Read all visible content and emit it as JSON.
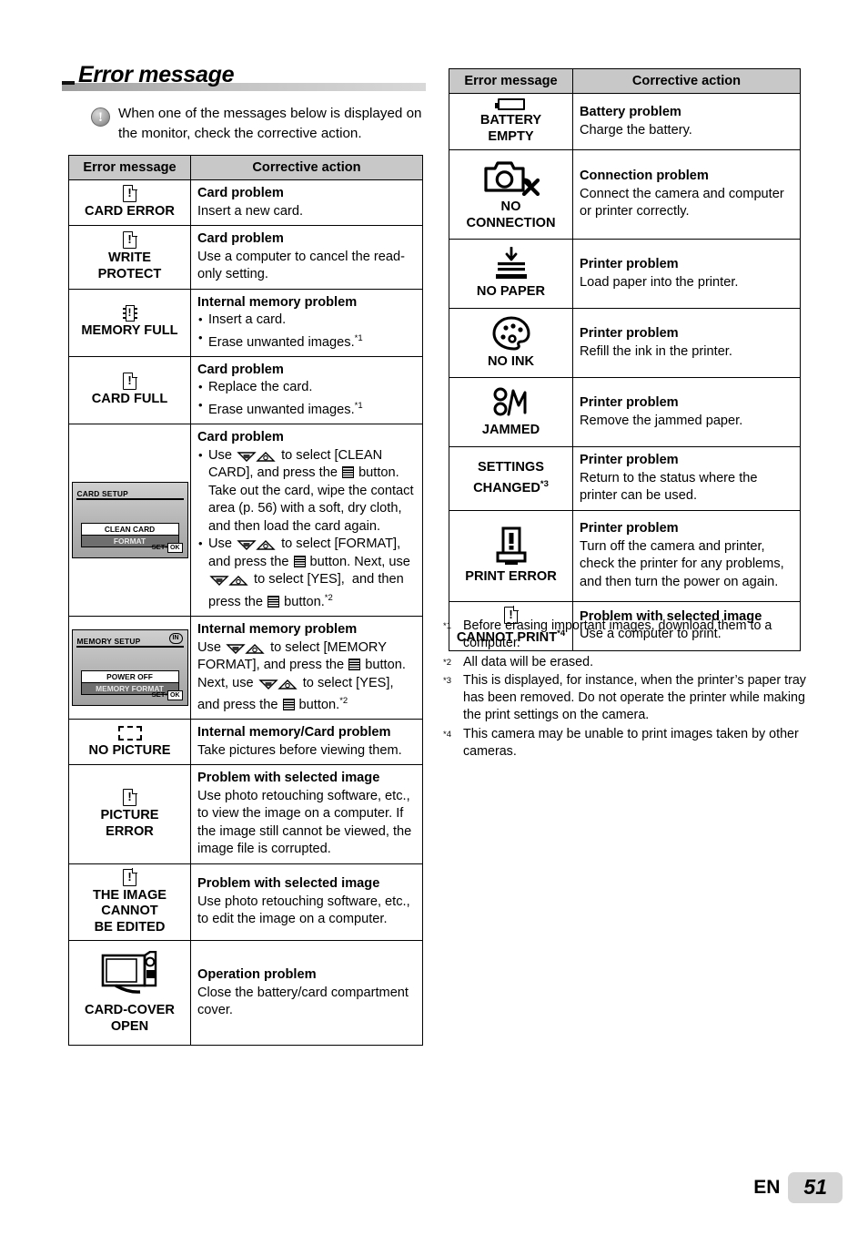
{
  "page": {
    "title": "Error message",
    "intro": "When one of the messages below is displayed on the monitor, check the corrective action.",
    "footer_lang": "EN",
    "footer_number": "51"
  },
  "table_headers": {
    "col_message": "Error message",
    "col_action": "Corrective action"
  },
  "left_table": [
    {
      "icon": "card-exclamation-icon",
      "label": "CARD ERROR",
      "action_heading": "Card problem",
      "action_lines": [
        "Insert a new card."
      ],
      "bullets": []
    },
    {
      "icon": "card-exclamation-icon",
      "label": "WRITE\nPROTECT",
      "action_heading": "Card problem",
      "action_lines": [
        "Use a computer to cancel the read-only setting."
      ],
      "bullets": []
    },
    {
      "icon": "memory-chip-exclamation-icon",
      "label": "MEMORY FULL",
      "action_heading": "Internal memory problem",
      "action_lines": [],
      "bullets": [
        "Insert a card.",
        "Erase unwanted images."
      ],
      "bullet_footnotes": [
        "",
        "*1"
      ]
    },
    {
      "icon": "card-exclamation-icon",
      "label": "CARD FULL",
      "action_heading": "Card problem",
      "action_lines": [],
      "bullets": [
        "Replace the card.",
        "Erase unwanted images."
      ],
      "bullet_footnotes": [
        "",
        "*1"
      ]
    },
    {
      "icon": "lcd-card-setup-screen",
      "label": "",
      "action_heading": "Card problem",
      "action_lines": [],
      "bullets": [
        "Use ▽/△ to select [CLEAN CARD], and press the ⊞ button. Take out the card, wipe the contact area (p. 56) with a soft, dry cloth, and then load the card again.",
        "Use ▽/△ to select [FORMAT], and press the ⊞ button. Next, use ▽/△ to select [YES],  and then press the ⊞ button."
      ],
      "bullet_footnotes": [
        "",
        "*2"
      ],
      "lcd": {
        "title": "CARD SETUP",
        "badge": "",
        "options": [
          "CLEAN CARD",
          "FORMAT"
        ],
        "footer": "SET•OK"
      }
    },
    {
      "icon": "lcd-memory-setup-screen",
      "label": "",
      "action_heading": "Internal memory problem",
      "action_lines": [
        "Use ▽/△ to select [MEMORY FORMAT], and press the ⊞ button. Next, use ▽/△ to select [YES], and press the ⊞ button."
      ],
      "bullets": [],
      "trailing_footnote": "*2",
      "lcd": {
        "title": "MEMORY SETUP",
        "badge": "IN",
        "options": [
          "POWER OFF",
          "MEMORY FORMAT"
        ],
        "footer": "SET•OK"
      }
    },
    {
      "icon": "dashed-frame-icon",
      "label": "NO PICTURE",
      "action_heading": "Internal memory/Card problem",
      "action_lines": [
        "Take pictures before viewing them."
      ],
      "bullets": []
    },
    {
      "icon": "card-exclamation-icon",
      "label": "PICTURE\nERROR",
      "action_heading": "Problem with selected image",
      "action_lines": [
        "Use photo retouching software, etc., to view the image on a computer. If the image still cannot be viewed, the image file is corrupted."
      ],
      "bullets": []
    },
    {
      "icon": "card-exclamation-icon",
      "label": "THE IMAGE\nCANNOT\nBE EDITED",
      "action_heading": "Problem with selected image",
      "action_lines": [
        "Use photo retouching software, etc., to edit the image on a computer."
      ],
      "bullets": []
    },
    {
      "icon": "camera-open-cover-icon",
      "label": "CARD-COVER\nOPEN",
      "action_heading": "Operation problem",
      "action_lines": [
        "Close the battery/card compartment cover."
      ],
      "bullets": []
    }
  ],
  "right_table": [
    {
      "icon": "battery-empty-icon",
      "label": "BATTERY\nEMPTY",
      "action_heading": "Battery problem",
      "action_lines": [
        "Charge the battery."
      ]
    },
    {
      "icon": "camera-no-connection-icon",
      "label": "NO\nCONNECTION",
      "action_heading": "Connection problem",
      "action_lines": [
        "Connect the camera and computer or printer correctly."
      ]
    },
    {
      "icon": "printer-no-paper-icon",
      "label": "NO PAPER",
      "action_heading": "Printer problem",
      "action_lines": [
        "Load paper into the printer."
      ]
    },
    {
      "icon": "ink-palette-icon",
      "label": "NO INK",
      "action_heading": "Printer problem",
      "action_lines": [
        "Refill the ink in the printer."
      ]
    },
    {
      "icon": "paper-jam-icon",
      "label": "JAMMED",
      "action_heading": "Printer problem",
      "action_lines": [
        "Remove the jammed paper."
      ]
    },
    {
      "icon": "",
      "label": "SETTINGS\nCHANGED",
      "label_footnote": "*3",
      "action_heading": "Printer problem",
      "action_lines": [
        "Return to the status where the printer can be used."
      ]
    },
    {
      "icon": "printer-error-icon",
      "label": "PRINT ERROR",
      "action_heading": "Printer problem",
      "action_lines": [
        "Turn off the camera and printer, check the printer for any problems, and then turn the power on again."
      ]
    },
    {
      "icon": "card-exclamation-icon",
      "label": "CANNOT PRINT",
      "label_footnote": "*4",
      "action_heading": "Problem with selected image",
      "action_lines": [
        "Use a computer to print."
      ]
    }
  ],
  "footnotes": [
    {
      "mark": "*1",
      "text": "Before erasing important images, download them to a computer."
    },
    {
      "mark": "*2",
      "text": "All data will be erased."
    },
    {
      "mark": "*3",
      "text": "This is displayed, for instance, when the printer’s paper tray has been removed. Do not operate the printer while making the print settings on the camera."
    },
    {
      "mark": "*4",
      "text": "This camera may be unable to print images taken by other cameras."
    }
  ],
  "colors": {
    "header_fill": "#c8c8c8",
    "rule_gray": "#c3c3c3",
    "page_badge": "#d5d5d5",
    "lcd_bg": "#b4b4b4"
  }
}
